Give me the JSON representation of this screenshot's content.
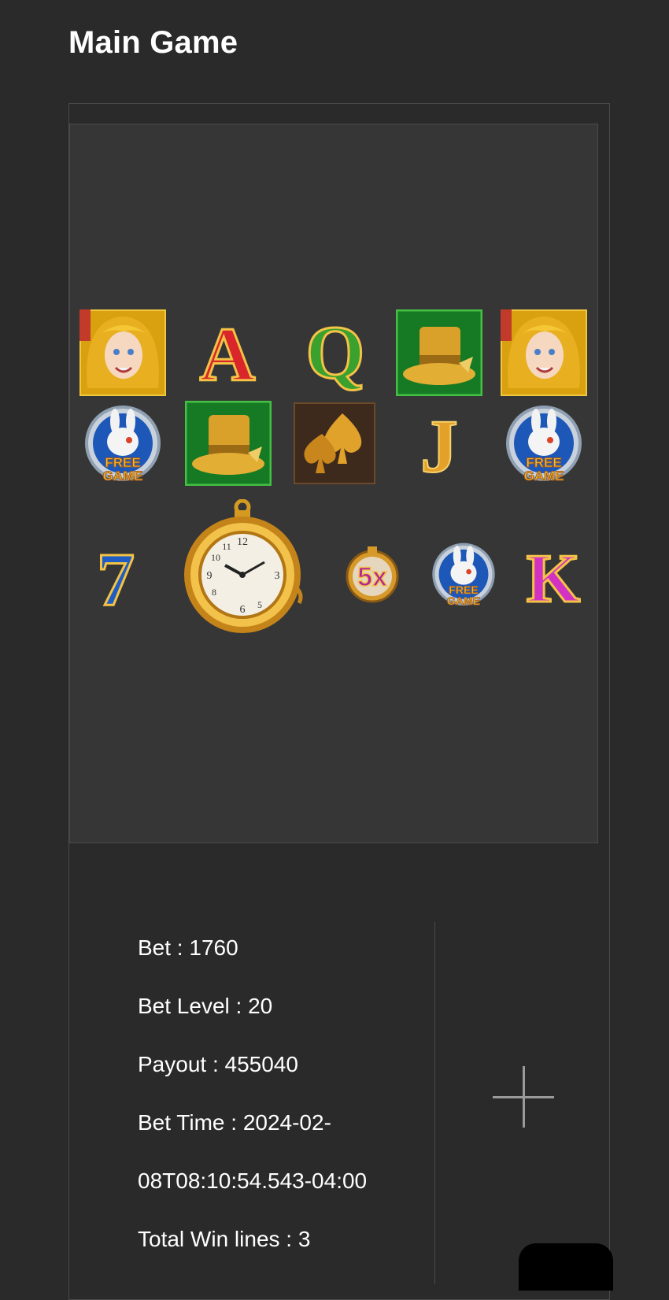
{
  "page": {
    "title": "Main Game"
  },
  "reels": {
    "row1": [
      {
        "symbol": "alice-portrait"
      },
      {
        "symbol": "ace",
        "label": "A"
      },
      {
        "symbol": "queen",
        "label": "Q"
      },
      {
        "symbol": "mad-hatter-hat"
      },
      {
        "symbol": "alice-portrait"
      }
    ],
    "row2": [
      {
        "symbol": "white-rabbit-free-game",
        "label": "FREE GAME"
      },
      {
        "symbol": "mad-hatter-hat"
      },
      {
        "symbol": "spades"
      },
      {
        "symbol": "jack",
        "label": "J"
      },
      {
        "symbol": "white-rabbit-free-game",
        "label": "FREE GAME"
      }
    ],
    "row3": [
      {
        "symbol": "seven",
        "label": "7"
      },
      {
        "symbol": "pocket-watch"
      },
      {
        "symbol": "multiplier",
        "label": "5x"
      },
      {
        "symbol": "white-rabbit-free-game",
        "label": "FREE GAME"
      },
      {
        "symbol": "king",
        "label": "K"
      }
    ]
  },
  "details": {
    "bet": "Bet : 1760",
    "bet_level": "Bet Level : 20",
    "payout": "Payout : 455040",
    "bet_time_1": "Bet Time : 2024-02-",
    "bet_time_2": "08T08:10:54.543-04:00",
    "total_win_lines": "Total Win lines : 3"
  },
  "colors": {
    "background": "#2a2a2a",
    "panel": "#363636",
    "border": "#4a4a4a",
    "text": "#ffffff"
  }
}
